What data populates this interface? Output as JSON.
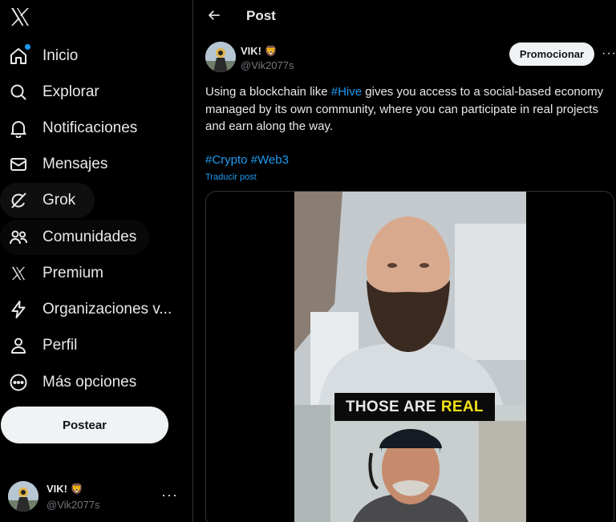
{
  "nav": {
    "items": [
      {
        "label": "Inicio",
        "icon": "home-icon"
      },
      {
        "label": "Explorar",
        "icon": "search-icon"
      },
      {
        "label": "Notificaciones",
        "icon": "bell-icon"
      },
      {
        "label": "Mensajes",
        "icon": "envelope-icon"
      },
      {
        "label": "Grok",
        "icon": "grok-icon"
      },
      {
        "label": "Comunidades",
        "icon": "people-icon"
      },
      {
        "label": "Premium",
        "icon": "x-logo-icon"
      },
      {
        "label": "Organizaciones v...",
        "icon": "lightning-icon"
      },
      {
        "label": "Perfil",
        "icon": "person-icon"
      },
      {
        "label": "Más opciones",
        "icon": "more-circle-icon"
      }
    ],
    "post_button": "Postear"
  },
  "account": {
    "name": "VIK! 🦁",
    "handle": "@Vik2077s",
    "more": "···"
  },
  "header": {
    "title": "Post"
  },
  "post": {
    "author_name": "VIK! 🦁",
    "author_handle": "@Vik2077s",
    "promote_label": "Promocionar",
    "more": "···",
    "text_before": "Using a blockchain like ",
    "text_link": "#Hive",
    "text_after": " gives you access to a social-based economy managed by its own community, where you can participate in real projects and earn along the way.",
    "hashtag_1": "#Crypto",
    "hashtag_2": "#Web3",
    "translate_label": "Traducir post"
  },
  "video": {
    "caption_white": "THOSE ARE",
    "caption_yellow": "REAL"
  },
  "colors": {
    "accent": "#1d9bf0",
    "background": "#000000",
    "caption_yellow": "#f5e11a"
  }
}
